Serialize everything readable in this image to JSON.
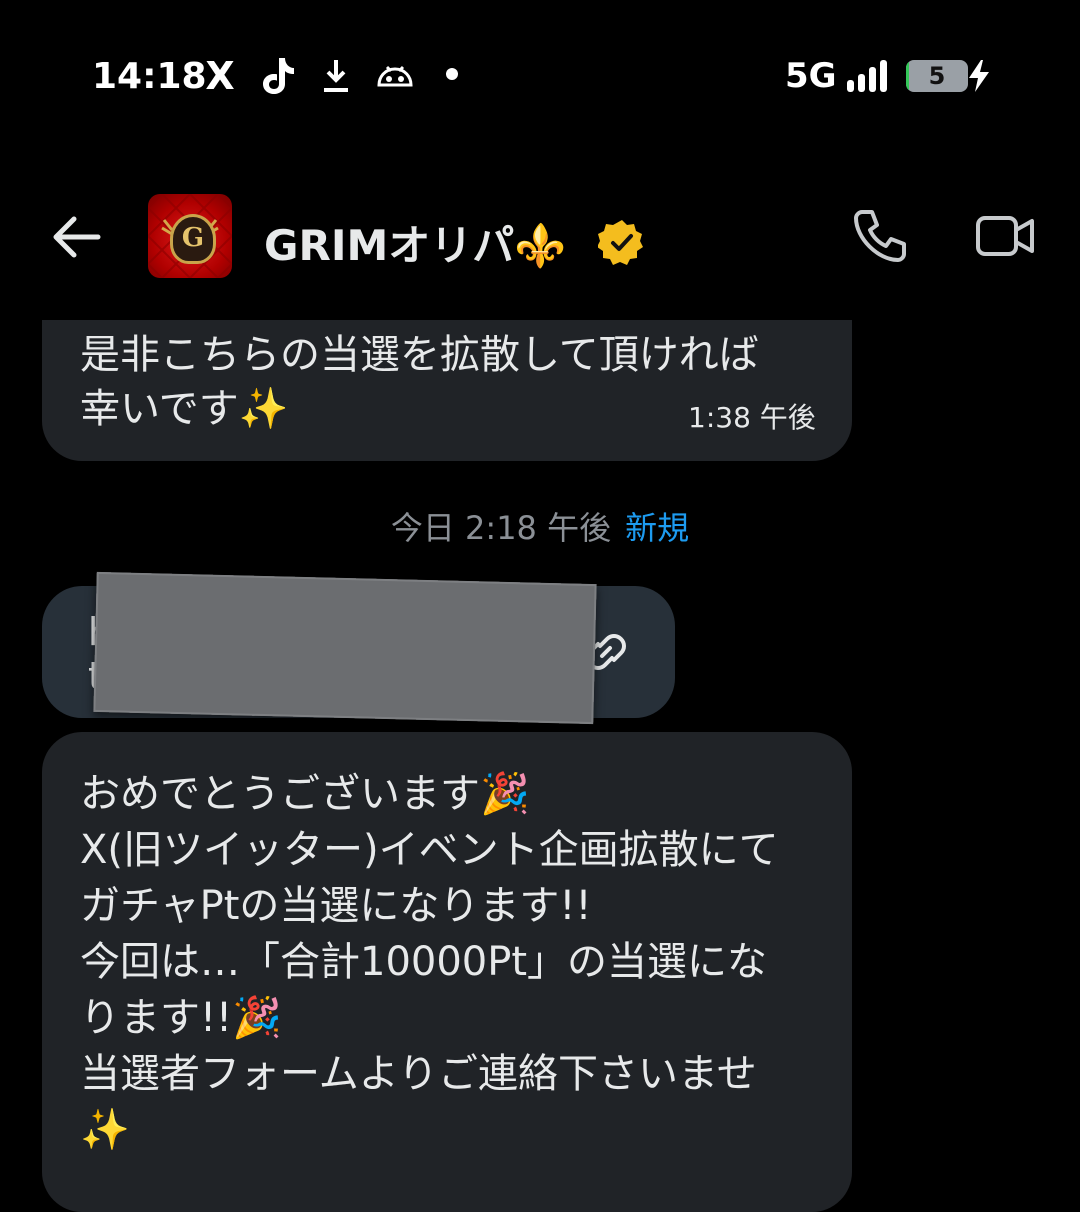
{
  "status_bar": {
    "time": "14:18",
    "x_logo": "X",
    "icons": [
      "x-logo-icon",
      "tiktok-icon",
      "download-icon",
      "dinosaur-icon",
      "dot-icon"
    ],
    "network": "5G",
    "battery_level": "5",
    "battery_percent": 5,
    "charging": true
  },
  "header": {
    "title": "GRIMオリパ⚜️",
    "avatar_letter": "G",
    "back_icon": "arrow-left-icon",
    "verified_icon": "verified-badge-icon",
    "call_icon": "phone-icon",
    "video_icon": "video-camera-icon",
    "colors": {
      "verified": "#f4bd1e",
      "avatar_bg": "#c40f0f"
    }
  },
  "messages": [
    {
      "id": "m1",
      "lines": [
        "是非こちらの当選を拡散して頂ければ",
        "幸いです✨"
      ],
      "time": "1:38 午後"
    },
    {
      "id": "m2",
      "link_text": "h",
      "link_text_2": "t",
      "link_icon": "link-icon"
    },
    {
      "id": "m3",
      "lines": [
        "おめでとうございます🎉",
        "X(旧ツイッター)イベント企画拡散にて",
        "ガチャPtの当選になります!!",
        "今回は…「合計10000Pt」の当選にな",
        "ります!!🎉",
        "当選者フォームよりご連絡下さいませ",
        "✨"
      ]
    }
  ],
  "day_separator": {
    "label": "今日 2:18 午後",
    "new_badge": "新規",
    "colors": {
      "label": "#8b9096",
      "new": "#1d9bf0"
    }
  },
  "colors": {
    "background": "#000000",
    "bubble": "#202327",
    "link_bubble": "#273039",
    "text": "#e7e9ea"
  }
}
